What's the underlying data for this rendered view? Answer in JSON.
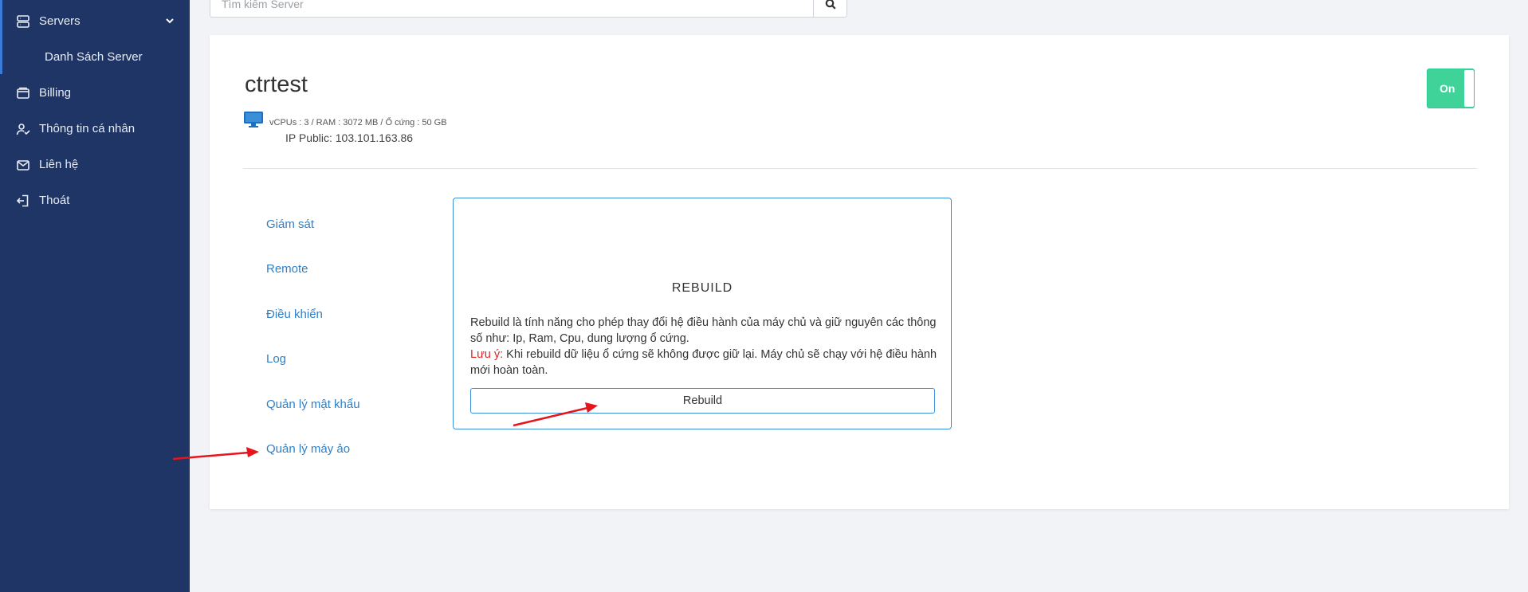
{
  "sidebar": {
    "items": [
      {
        "label": "Servers",
        "icon": "server-icon"
      },
      {
        "label": "Danh Sách Server"
      },
      {
        "label": "Billing",
        "icon": "wallet-icon"
      },
      {
        "label": "Thông tin cá nhân",
        "icon": "user-check-icon"
      },
      {
        "label": "Liên hệ",
        "icon": "mail-icon"
      },
      {
        "label": "Thoát",
        "icon": "logout-icon"
      }
    ]
  },
  "search": {
    "placeholder": "Tìm kiếm Server",
    "icon": "search-icon"
  },
  "server": {
    "name": "ctrtest",
    "specs": "vCPUs : 3 / RAM : 3072 MB / Ổ cứng : 50 GB",
    "ip": "IP Public: 103.101.163.86",
    "power_state": "On",
    "monitor_icon": "monitor-icon"
  },
  "menu": [
    {
      "label": "Giám sát"
    },
    {
      "label": "Remote"
    },
    {
      "label": "Điều khiển"
    },
    {
      "label": "Log"
    },
    {
      "label": "Quản lý mật khẩu"
    },
    {
      "label": "Quản lý máy ảo"
    }
  ],
  "rebuild": {
    "title": "REBUILD",
    "description": "Rebuild là tính năng cho phép thay đổi hệ điều hành của máy chủ và giữ nguyên các thông số như: Ip, Ram, Cpu, dung lượng ổ cứng.",
    "warning_label": "Lưu ý:",
    "warning_text": " Khi rebuild dữ liệu ổ cứng sẽ không được giữ lại. Máy chủ sẽ chạy với hệ điều hành mới hoàn toàn.",
    "button_label": "Rebuild"
  },
  "colors": {
    "sidebar_bg": "#1f3566",
    "accent": "#2f80c9",
    "toggle_on": "#3fd39a",
    "warning": "#e02424",
    "annotation_arrow": "#e8141b"
  }
}
